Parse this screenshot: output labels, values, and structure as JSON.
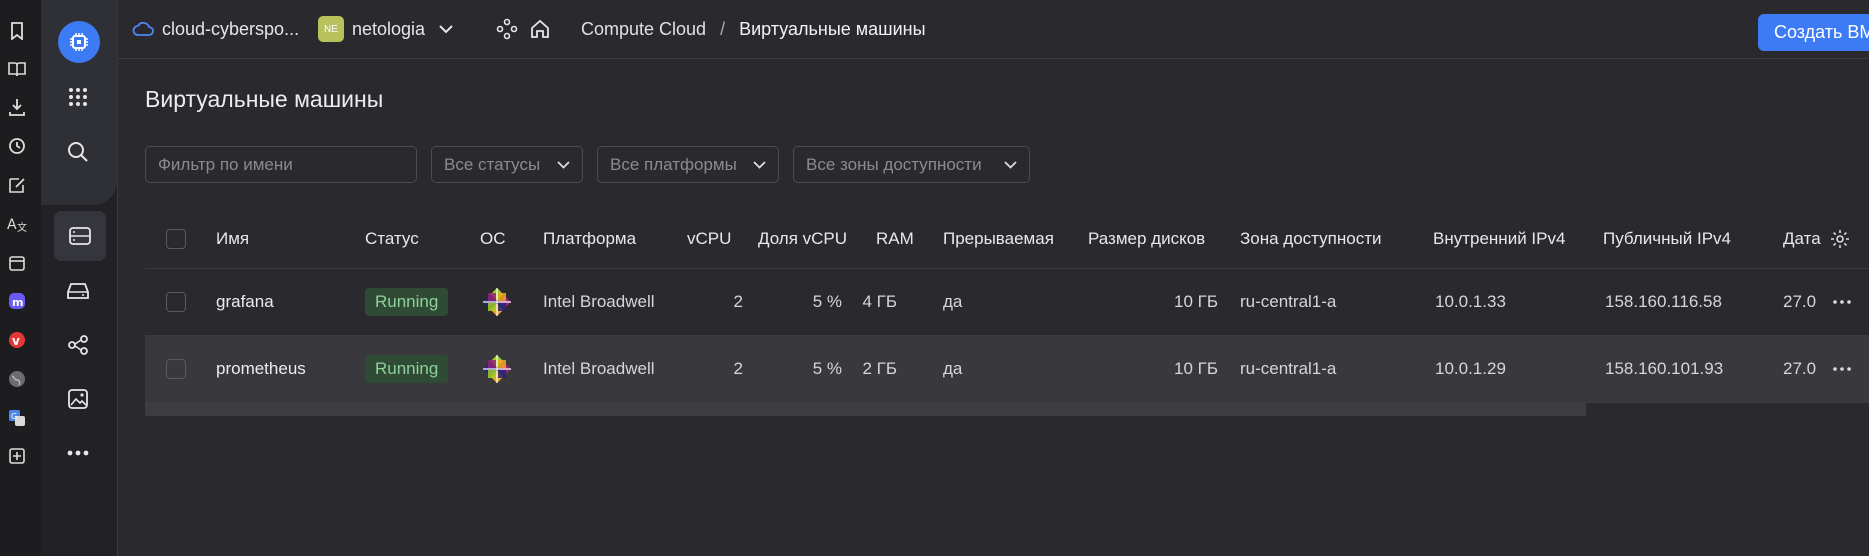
{
  "topbar": {
    "cloud_name": "cloud-cyberspo...",
    "folder_badge": "NE",
    "folder_name": "netologia",
    "breadcrumb_service": "Compute Cloud",
    "breadcrumb_sep": "/",
    "breadcrumb_current": "Виртуальные машины",
    "create_button": "Создать ВМ"
  },
  "page": {
    "title": "Виртуальные машины"
  },
  "filters": {
    "name_placeholder": "Фильтр по имени",
    "status": "Все статусы",
    "platform": "Все платформы",
    "zone": "Все зоны доступности"
  },
  "table": {
    "columns": [
      "Имя",
      "Статус",
      "ОС",
      "Платформа",
      "vCPU",
      "Доля vCPU",
      "RAM",
      "Прерываемая",
      "Размер дисков",
      "Зона доступности",
      "Внутренний IPv4",
      "Публичный IPv4",
      "Дата"
    ],
    "rows": [
      {
        "name": "grafana",
        "status": "Running",
        "platform": "Intel Broadwell",
        "vcpu": "2",
        "share": "5 %",
        "ram": "4 ГБ",
        "preemptible": "да",
        "disk": "10 ГБ",
        "zone": "ru-central1-a",
        "int_ip": "10.0.1.33",
        "pub_ip": "158.160.116.58",
        "date": "27.0"
      },
      {
        "name": "prometheus",
        "status": "Running",
        "platform": "Intel Broadwell",
        "vcpu": "2",
        "share": "5 %",
        "ram": "2 ГБ",
        "preemptible": "да",
        "disk": "10 ГБ",
        "zone": "ru-central1-a",
        "int_ip": "10.0.1.29",
        "pub_ip": "158.160.101.93",
        "date": "27.0"
      }
    ]
  },
  "icons": {
    "browser_rail": [
      "bookmark-icon",
      "reader-icon",
      "download-icon",
      "history-icon",
      "notes-icon",
      "translate-icon",
      "calendar-icon",
      "mastodon-icon",
      "vivaldi-icon",
      "globe-icon",
      "google-translate-icon",
      "add-panel-icon"
    ],
    "app_nav": [
      "compute-cloud-icon",
      "all-services-icon",
      "search-icon",
      "vm-icon",
      "disk-icon",
      "network-icon",
      "image-icon",
      "more-icon"
    ]
  },
  "colors": {
    "accent": "#3d7bf4",
    "running_bg": "#2f4a35",
    "running_text": "#8fd19a",
    "folder_badge": "#b7c25c"
  }
}
